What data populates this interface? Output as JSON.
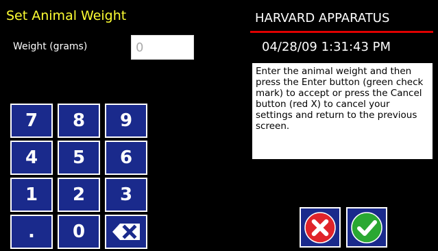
{
  "screen": {
    "title": "Set Animal Weight"
  },
  "weight": {
    "label": "Weight (grams)",
    "value": "0"
  },
  "brand": {
    "name": "HARVARD APPARATUS",
    "datetime": "04/28/09 1:31:43 PM"
  },
  "help": {
    "text": "Enter the animal weight and then press the Enter button (green check mark) to accept or press the Cancel button (red X) to cancel your settings and return to the previous screen."
  },
  "keypad": {
    "k7": "7",
    "k8": "8",
    "k9": "9",
    "k4": "4",
    "k5": "5",
    "k6": "6",
    "k1": "1",
    "k2": "2",
    "k3": "3",
    "dot": ".",
    "k0": "0",
    "backspace_icon": "backspace-icon"
  },
  "actions": {
    "cancel_icon": "red-x-icon",
    "enter_icon": "green-check-icon"
  },
  "colors": {
    "key_bg": "#1a2a8c",
    "title": "#ffff33",
    "rule": "#e00000",
    "cancel": "#e0242a",
    "enter": "#2aa832"
  }
}
